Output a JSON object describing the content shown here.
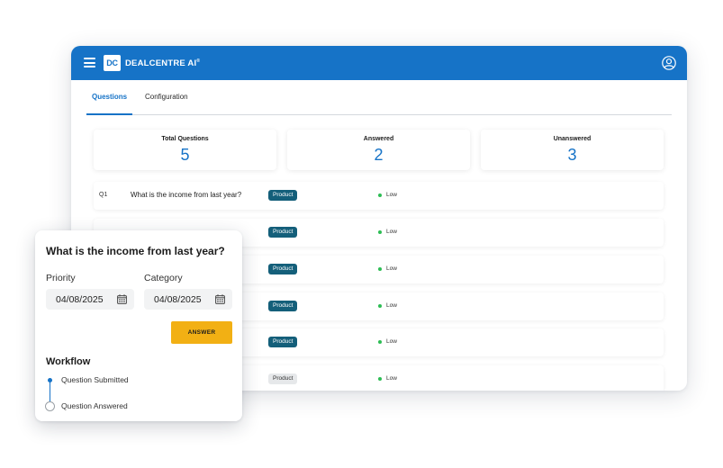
{
  "app": {
    "logo_mark": "DC",
    "logo_text": "DEALCENTRE AI",
    "trademark": "®"
  },
  "tabs": [
    {
      "label": "Questions",
      "active": true
    },
    {
      "label": "Configuration",
      "active": false
    }
  ],
  "stats": [
    {
      "label": "Total Questions",
      "value": "5"
    },
    {
      "label": "Answered",
      "value": "2"
    },
    {
      "label": "Unanswered",
      "value": "3"
    }
  ],
  "questions": [
    {
      "id": "Q1",
      "text": "What is the income from last year?",
      "tag": "Product",
      "priority": "Low"
    },
    {
      "id": "",
      "text": "",
      "tag": "Product",
      "priority": "Low"
    },
    {
      "id": "",
      "text": "",
      "tag": "Product",
      "priority": "Low"
    },
    {
      "id": "",
      "text": "",
      "tag": "Product",
      "priority": "Low"
    },
    {
      "id": "",
      "text": "",
      "tag": "Product",
      "priority": "Low"
    },
    {
      "id": "",
      "text": "",
      "tag": "Product",
      "priority": "Low"
    }
  ],
  "popup": {
    "title": "What is the income from last year?",
    "priority_label": "Priority",
    "priority_value": "04/08/2025",
    "category_label": "Category",
    "category_value": "04/08/2025",
    "answer_label": "ANSWER",
    "workflow_title": "Workflow",
    "steps": [
      "Question Submitted",
      "Question Answered"
    ]
  },
  "colors": {
    "brand_blue": "#1673c7",
    "tag_teal": "#145f7a",
    "answer_yellow": "#f2b014",
    "priority_low_green": "#2dbd54"
  },
  "icons": [
    "menu-icon",
    "user-account-icon",
    "calendar-icon",
    "status-dot-icon"
  ]
}
